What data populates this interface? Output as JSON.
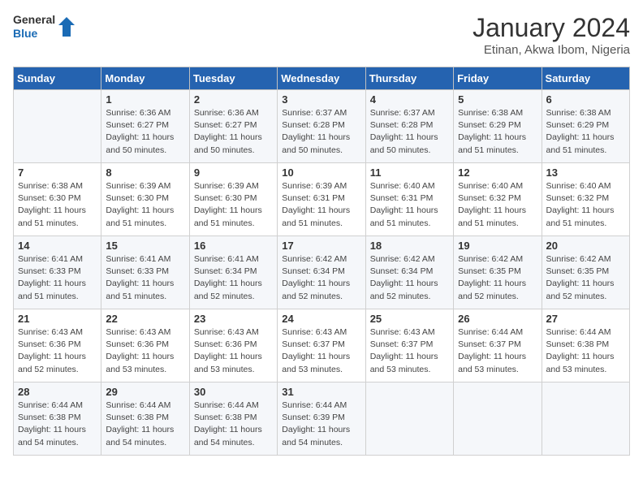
{
  "logo": {
    "general": "General",
    "blue": "Blue"
  },
  "header": {
    "month": "January 2024",
    "location": "Etinan, Akwa Ibom, Nigeria"
  },
  "weekdays": [
    "Sunday",
    "Monday",
    "Tuesday",
    "Wednesday",
    "Thursday",
    "Friday",
    "Saturday"
  ],
  "weeks": [
    [
      {
        "day": "",
        "sunrise": "",
        "sunset": "",
        "daylight": ""
      },
      {
        "day": "1",
        "sunrise": "Sunrise: 6:36 AM",
        "sunset": "Sunset: 6:27 PM",
        "daylight": "Daylight: 11 hours and 50 minutes."
      },
      {
        "day": "2",
        "sunrise": "Sunrise: 6:36 AM",
        "sunset": "Sunset: 6:27 PM",
        "daylight": "Daylight: 11 hours and 50 minutes."
      },
      {
        "day": "3",
        "sunrise": "Sunrise: 6:37 AM",
        "sunset": "Sunset: 6:28 PM",
        "daylight": "Daylight: 11 hours and 50 minutes."
      },
      {
        "day": "4",
        "sunrise": "Sunrise: 6:37 AM",
        "sunset": "Sunset: 6:28 PM",
        "daylight": "Daylight: 11 hours and 50 minutes."
      },
      {
        "day": "5",
        "sunrise": "Sunrise: 6:38 AM",
        "sunset": "Sunset: 6:29 PM",
        "daylight": "Daylight: 11 hours and 51 minutes."
      },
      {
        "day": "6",
        "sunrise": "Sunrise: 6:38 AM",
        "sunset": "Sunset: 6:29 PM",
        "daylight": "Daylight: 11 hours and 51 minutes."
      }
    ],
    [
      {
        "day": "7",
        "sunrise": "Sunrise: 6:38 AM",
        "sunset": "Sunset: 6:30 PM",
        "daylight": "Daylight: 11 hours and 51 minutes."
      },
      {
        "day": "8",
        "sunrise": "Sunrise: 6:39 AM",
        "sunset": "Sunset: 6:30 PM",
        "daylight": "Daylight: 11 hours and 51 minutes."
      },
      {
        "day": "9",
        "sunrise": "Sunrise: 6:39 AM",
        "sunset": "Sunset: 6:30 PM",
        "daylight": "Daylight: 11 hours and 51 minutes."
      },
      {
        "day": "10",
        "sunrise": "Sunrise: 6:39 AM",
        "sunset": "Sunset: 6:31 PM",
        "daylight": "Daylight: 11 hours and 51 minutes."
      },
      {
        "day": "11",
        "sunrise": "Sunrise: 6:40 AM",
        "sunset": "Sunset: 6:31 PM",
        "daylight": "Daylight: 11 hours and 51 minutes."
      },
      {
        "day": "12",
        "sunrise": "Sunrise: 6:40 AM",
        "sunset": "Sunset: 6:32 PM",
        "daylight": "Daylight: 11 hours and 51 minutes."
      },
      {
        "day": "13",
        "sunrise": "Sunrise: 6:40 AM",
        "sunset": "Sunset: 6:32 PM",
        "daylight": "Daylight: 11 hours and 51 minutes."
      }
    ],
    [
      {
        "day": "14",
        "sunrise": "Sunrise: 6:41 AM",
        "sunset": "Sunset: 6:33 PM",
        "daylight": "Daylight: 11 hours and 51 minutes."
      },
      {
        "day": "15",
        "sunrise": "Sunrise: 6:41 AM",
        "sunset": "Sunset: 6:33 PM",
        "daylight": "Daylight: 11 hours and 51 minutes."
      },
      {
        "day": "16",
        "sunrise": "Sunrise: 6:41 AM",
        "sunset": "Sunset: 6:34 PM",
        "daylight": "Daylight: 11 hours and 52 minutes."
      },
      {
        "day": "17",
        "sunrise": "Sunrise: 6:42 AM",
        "sunset": "Sunset: 6:34 PM",
        "daylight": "Daylight: 11 hours and 52 minutes."
      },
      {
        "day": "18",
        "sunrise": "Sunrise: 6:42 AM",
        "sunset": "Sunset: 6:34 PM",
        "daylight": "Daylight: 11 hours and 52 minutes."
      },
      {
        "day": "19",
        "sunrise": "Sunrise: 6:42 AM",
        "sunset": "Sunset: 6:35 PM",
        "daylight": "Daylight: 11 hours and 52 minutes."
      },
      {
        "day": "20",
        "sunrise": "Sunrise: 6:42 AM",
        "sunset": "Sunset: 6:35 PM",
        "daylight": "Daylight: 11 hours and 52 minutes."
      }
    ],
    [
      {
        "day": "21",
        "sunrise": "Sunrise: 6:43 AM",
        "sunset": "Sunset: 6:36 PM",
        "daylight": "Daylight: 11 hours and 52 minutes."
      },
      {
        "day": "22",
        "sunrise": "Sunrise: 6:43 AM",
        "sunset": "Sunset: 6:36 PM",
        "daylight": "Daylight: 11 hours and 53 minutes."
      },
      {
        "day": "23",
        "sunrise": "Sunrise: 6:43 AM",
        "sunset": "Sunset: 6:36 PM",
        "daylight": "Daylight: 11 hours and 53 minutes."
      },
      {
        "day": "24",
        "sunrise": "Sunrise: 6:43 AM",
        "sunset": "Sunset: 6:37 PM",
        "daylight": "Daylight: 11 hours and 53 minutes."
      },
      {
        "day": "25",
        "sunrise": "Sunrise: 6:43 AM",
        "sunset": "Sunset: 6:37 PM",
        "daylight": "Daylight: 11 hours and 53 minutes."
      },
      {
        "day": "26",
        "sunrise": "Sunrise: 6:44 AM",
        "sunset": "Sunset: 6:37 PM",
        "daylight": "Daylight: 11 hours and 53 minutes."
      },
      {
        "day": "27",
        "sunrise": "Sunrise: 6:44 AM",
        "sunset": "Sunset: 6:38 PM",
        "daylight": "Daylight: 11 hours and 53 minutes."
      }
    ],
    [
      {
        "day": "28",
        "sunrise": "Sunrise: 6:44 AM",
        "sunset": "Sunset: 6:38 PM",
        "daylight": "Daylight: 11 hours and 54 minutes."
      },
      {
        "day": "29",
        "sunrise": "Sunrise: 6:44 AM",
        "sunset": "Sunset: 6:38 PM",
        "daylight": "Daylight: 11 hours and 54 minutes."
      },
      {
        "day": "30",
        "sunrise": "Sunrise: 6:44 AM",
        "sunset": "Sunset: 6:38 PM",
        "daylight": "Daylight: 11 hours and 54 minutes."
      },
      {
        "day": "31",
        "sunrise": "Sunrise: 6:44 AM",
        "sunset": "Sunset: 6:39 PM",
        "daylight": "Daylight: 11 hours and 54 minutes."
      },
      {
        "day": "",
        "sunrise": "",
        "sunset": "",
        "daylight": ""
      },
      {
        "day": "",
        "sunrise": "",
        "sunset": "",
        "daylight": ""
      },
      {
        "day": "",
        "sunrise": "",
        "sunset": "",
        "daylight": ""
      }
    ]
  ]
}
